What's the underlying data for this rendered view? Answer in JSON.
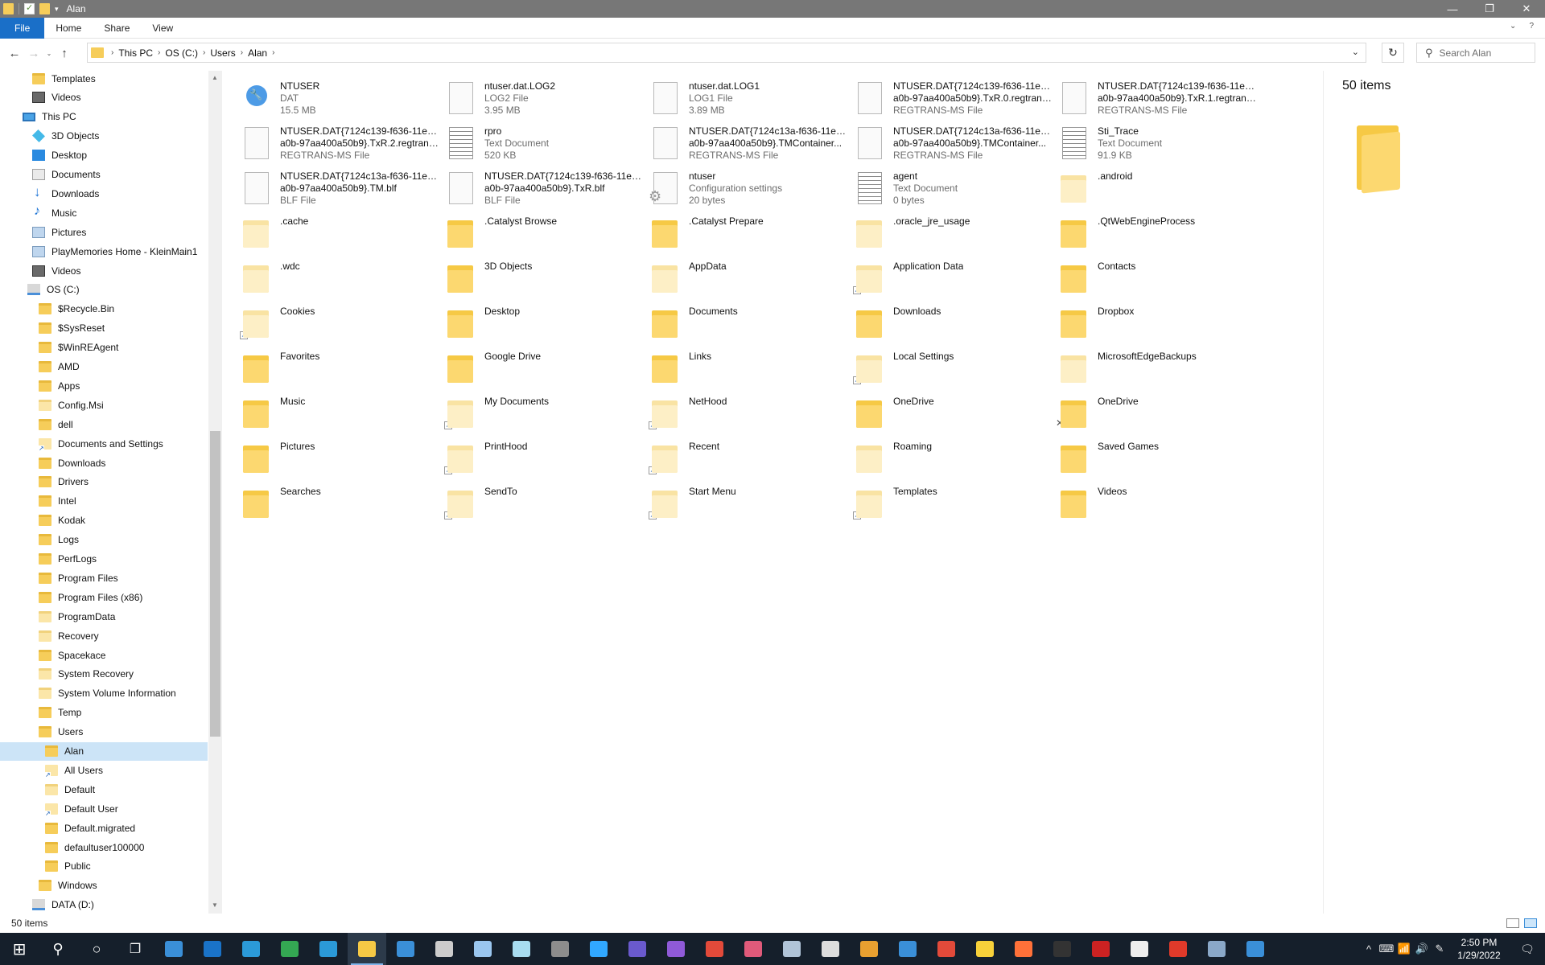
{
  "window": {
    "title": "Alan"
  },
  "titlebar": {
    "minimize": "—",
    "maximize": "❐",
    "close": "✕",
    "qa_dropdown": "▾"
  },
  "ribbon": {
    "tabs": [
      "File",
      "Home",
      "Share",
      "View"
    ],
    "expand": "⌄",
    "help": "?"
  },
  "nav": {
    "back": "←",
    "forward": "→",
    "recent": "⌄",
    "up": "↑"
  },
  "address": {
    "crumbs": [
      "This PC",
      "OS (C:)",
      "Users",
      "Alan"
    ],
    "separator": "›",
    "dropdown": "⌄"
  },
  "refresh": "↻",
  "search": {
    "placeholder": "Search Alan",
    "icon": "search-icon"
  },
  "navpane": {
    "items": [
      {
        "label": "Templates",
        "icon": "folder"
      },
      {
        "label": "Videos",
        "icon": "videos"
      },
      {
        "label": "This PC",
        "icon": "pc"
      },
      {
        "label": "3D Objects",
        "icon": "cube"
      },
      {
        "label": "Desktop",
        "icon": "desktop"
      },
      {
        "label": "Documents",
        "icon": "docs"
      },
      {
        "label": "Downloads",
        "icon": "down"
      },
      {
        "label": "Music",
        "icon": "music"
      },
      {
        "label": "Pictures",
        "icon": "pics"
      },
      {
        "label": "PlayMemories Home - KleinMain1",
        "icon": "pics"
      },
      {
        "label": "Videos",
        "icon": "videos"
      },
      {
        "label": "OS (C:)",
        "icon": "drive"
      },
      {
        "label": "$Recycle.Bin",
        "icon": "folder"
      },
      {
        "label": "$SysReset",
        "icon": "folder"
      },
      {
        "label": "$WinREAgent",
        "icon": "folder"
      },
      {
        "label": "AMD",
        "icon": "folder"
      },
      {
        "label": "Apps",
        "icon": "folder"
      },
      {
        "label": "Config.Msi",
        "icon": "folder-light"
      },
      {
        "label": "dell",
        "icon": "folder"
      },
      {
        "label": "Documents and Settings",
        "icon": "folder-link"
      },
      {
        "label": "Downloads",
        "icon": "folder"
      },
      {
        "label": "Drivers",
        "icon": "folder"
      },
      {
        "label": "Intel",
        "icon": "folder"
      },
      {
        "label": "Kodak",
        "icon": "folder"
      },
      {
        "label": "Logs",
        "icon": "folder"
      },
      {
        "label": "PerfLogs",
        "icon": "folder"
      },
      {
        "label": "Program Files",
        "icon": "folder"
      },
      {
        "label": "Program Files (x86)",
        "icon": "folder"
      },
      {
        "label": "ProgramData",
        "icon": "folder-light"
      },
      {
        "label": "Recovery",
        "icon": "folder-light"
      },
      {
        "label": "Spacekace",
        "icon": "folder"
      },
      {
        "label": "System Recovery",
        "icon": "folder-light"
      },
      {
        "label": "System Volume Information",
        "icon": "folder-light"
      },
      {
        "label": "Temp",
        "icon": "folder"
      },
      {
        "label": "Users",
        "icon": "folder"
      },
      {
        "label": "Alan",
        "icon": "folder"
      },
      {
        "label": "All Users",
        "icon": "folder-link"
      },
      {
        "label": "Default",
        "icon": "folder-light"
      },
      {
        "label": "Default User",
        "icon": "folder-link"
      },
      {
        "label": "Default.migrated",
        "icon": "folder"
      },
      {
        "label": "defaultuser100000",
        "icon": "folder"
      },
      {
        "label": "Public",
        "icon": "folder"
      },
      {
        "label": "Windows",
        "icon": "folder"
      },
      {
        "label": "DATA (D:)",
        "icon": "drive"
      }
    ]
  },
  "content": {
    "items": [
      {
        "name": "NTUSER",
        "type": "DAT",
        "size": "15.5 MB",
        "icon": "wrench-icon"
      },
      {
        "name": "ntuser.dat.LOG2",
        "type": "LOG2 File",
        "size": "3.95 MB",
        "icon": "file-icon"
      },
      {
        "name": "ntuser.dat.LOG1",
        "type": "LOG1 File",
        "size": "3.89 MB",
        "icon": "file-icon"
      },
      {
        "name": "NTUSER.DAT{7124c139-f636-11ea-8",
        "name2": "a0b-97aa400a50b9}.TxR.0.regtrans...",
        "type": "REGTRANS-MS File",
        "icon": "file-icon"
      },
      {
        "name": "NTUSER.DAT{7124c139-f636-11ea-8",
        "name2": "a0b-97aa400a50b9}.TxR.1.regtrans...",
        "type": "REGTRANS-MS File",
        "icon": "file-icon"
      },
      {
        "name": "NTUSER.DAT{7124c139-f636-11ea-8",
        "name2": "a0b-97aa400a50b9}.TxR.2.regtrans...",
        "type": "REGTRANS-MS File",
        "icon": "file-icon"
      },
      {
        "name": "rpro",
        "type": "Text Document",
        "size": "520 KB",
        "icon": "text-file-icon"
      },
      {
        "name": "NTUSER.DAT{7124c13a-f636-11ea-8",
        "name2": "a0b-97aa400a50b9}.TMContainer...",
        "type": "REGTRANS-MS File",
        "icon": "file-icon"
      },
      {
        "name": "NTUSER.DAT{7124c13a-f636-11ea-8",
        "name2": "a0b-97aa400a50b9}.TMContainer...",
        "type": "REGTRANS-MS File",
        "icon": "file-icon"
      },
      {
        "name": "Sti_Trace",
        "type": "Text Document",
        "size": "91.9 KB",
        "icon": "text-file-icon"
      },
      {
        "name": "NTUSER.DAT{7124c13a-f636-11ea-8",
        "name2": "a0b-97aa400a50b9}.TM.blf",
        "type": "BLF File",
        "icon": "file-icon"
      },
      {
        "name": "NTUSER.DAT{7124c139-f636-11ea-8",
        "name2": "a0b-97aa400a50b9}.TxR.blf",
        "type": "BLF File",
        "icon": "file-icon"
      },
      {
        "name": "ntuser",
        "type": "Configuration settings",
        "size": "20 bytes",
        "icon": "config-file-icon"
      },
      {
        "name": "agent",
        "type": "Text Document",
        "size": "0 bytes",
        "icon": "text-file-icon"
      },
      {
        "name": ".android",
        "icon": "folder-light-icon"
      },
      {
        "name": ".cache",
        "icon": "folder-light-icon"
      },
      {
        "name": ".Catalyst Browse",
        "icon": "folder-icon"
      },
      {
        "name": ".Catalyst Prepare",
        "icon": "folder-icon"
      },
      {
        "name": ".oracle_jre_usage",
        "icon": "folder-light-icon"
      },
      {
        "name": ".QtWebEngineProcess",
        "icon": "folder-icon"
      },
      {
        "name": ".wdc",
        "icon": "folder-light-icon"
      },
      {
        "name": "3D Objects",
        "icon": "3d-objects-folder-icon"
      },
      {
        "name": "AppData",
        "icon": "folder-light-icon"
      },
      {
        "name": "Application Data",
        "icon": "folder-shortcut-icon"
      },
      {
        "name": "Contacts",
        "icon": "contacts-folder-icon"
      },
      {
        "name": "Cookies",
        "icon": "folder-shortcut-icon"
      },
      {
        "name": "Desktop",
        "icon": "desktop-folder-icon"
      },
      {
        "name": "Documents",
        "icon": "documents-folder-icon"
      },
      {
        "name": "Downloads",
        "icon": "downloads-folder-icon"
      },
      {
        "name": "Dropbox",
        "icon": "folder-icon"
      },
      {
        "name": "Favorites",
        "icon": "favorites-folder-icon"
      },
      {
        "name": "Google Drive",
        "icon": "google-drive-folder-icon"
      },
      {
        "name": "Links",
        "icon": "links-folder-icon"
      },
      {
        "name": "Local Settings",
        "icon": "folder-shortcut-icon"
      },
      {
        "name": "MicrosoftEdgeBackups",
        "icon": "folder-light-icon"
      },
      {
        "name": "Music",
        "icon": "music-folder-icon"
      },
      {
        "name": "My Documents",
        "icon": "documents-shortcut-icon"
      },
      {
        "name": "NetHood",
        "icon": "folder-shortcut-icon"
      },
      {
        "name": "OneDrive",
        "icon": "onedrive-folder-icon"
      },
      {
        "name": "OneDrive",
        "icon": "onedrive-error-folder-icon"
      },
      {
        "name": "Pictures",
        "icon": "pictures-folder-icon"
      },
      {
        "name": "PrintHood",
        "icon": "folder-shortcut-icon"
      },
      {
        "name": "Recent",
        "icon": "recent-shortcut-icon"
      },
      {
        "name": "Roaming",
        "icon": "folder-light-icon"
      },
      {
        "name": "Saved Games",
        "icon": "saved-games-folder-icon"
      },
      {
        "name": "Searches",
        "icon": "searches-folder-icon"
      },
      {
        "name": "SendTo",
        "icon": "folder-shortcut-icon"
      },
      {
        "name": "Start Menu",
        "icon": "folder-shortcut-icon"
      },
      {
        "name": "Templates",
        "icon": "folder-shortcut-icon"
      },
      {
        "name": "Videos",
        "icon": "videos-folder-icon"
      }
    ]
  },
  "details": {
    "count": "50 items"
  },
  "status": {
    "count": "50 items"
  },
  "taskbar": {
    "apps": [
      {
        "icon": "start-icon",
        "color": "#ffffff"
      },
      {
        "icon": "search-icon",
        "color": "#ffffff"
      },
      {
        "icon": "cortana-icon",
        "color": "#ffffff"
      },
      {
        "icon": "task-view-icon",
        "color": "#ffffff"
      },
      {
        "icon": "people-icon",
        "color": "#3a8fd8"
      },
      {
        "icon": "outlook-icon",
        "color": "#1a73c8"
      },
      {
        "icon": "edge-icon",
        "color": "#2b9ad8"
      },
      {
        "icon": "chrome-icon",
        "color": "#34a853"
      },
      {
        "icon": "internet-explorer-icon",
        "color": "#2b9ad8"
      },
      {
        "icon": "file-explorer-icon",
        "color": "#f6c945"
      },
      {
        "icon": "store-icon",
        "color": "#3a8fd8"
      },
      {
        "icon": "news-icon",
        "color": "#cccccc"
      },
      {
        "icon": "notepad-icon",
        "color": "#9ac6ef"
      },
      {
        "icon": "paper-icon",
        "color": "#a8dcf0"
      },
      {
        "icon": "calculator-icon",
        "color": "#8d8d8d"
      },
      {
        "icon": "lightroom-icon",
        "color": "#31a8ff"
      },
      {
        "icon": "app-purple-icon",
        "color": "#6a5acd"
      },
      {
        "icon": "app-hexagon-icon",
        "color": "#8f5ad8"
      },
      {
        "icon": "app-paint-icon",
        "color": "#e24a3a"
      },
      {
        "icon": "davinci-icon",
        "color": "#e05a7a"
      },
      {
        "icon": "app-disc-icon",
        "color": "#b0c4d8"
      },
      {
        "icon": "app-check-icon",
        "color": "#dddddd"
      },
      {
        "icon": "app-colorful-icon",
        "color": "#e8a030"
      },
      {
        "icon": "remote-desktop-icon",
        "color": "#3a8fd8"
      },
      {
        "icon": "app-red-icon",
        "color": "#e24a3a"
      },
      {
        "icon": "sticky-notes-icon",
        "color": "#f7d13a"
      },
      {
        "icon": "firefox-icon",
        "color": "#ff7139"
      },
      {
        "icon": "app-film-icon",
        "color": "#333333"
      },
      {
        "icon": "app-bug-icon",
        "color": "#cc2222"
      },
      {
        "icon": "app-panda-icon",
        "color": "#eeeeee"
      },
      {
        "icon": "acrobat-icon",
        "color": "#e03a2a"
      },
      {
        "icon": "app-tools-icon",
        "color": "#8aa8c8"
      },
      {
        "icon": "app-screen-icon",
        "color": "#3a8fd8"
      }
    ],
    "tray": [
      "^",
      "⌨",
      "📶",
      "🔊",
      "✎"
    ],
    "time": "2:50 PM",
    "date": "1/29/2022",
    "notif": "🗨"
  }
}
